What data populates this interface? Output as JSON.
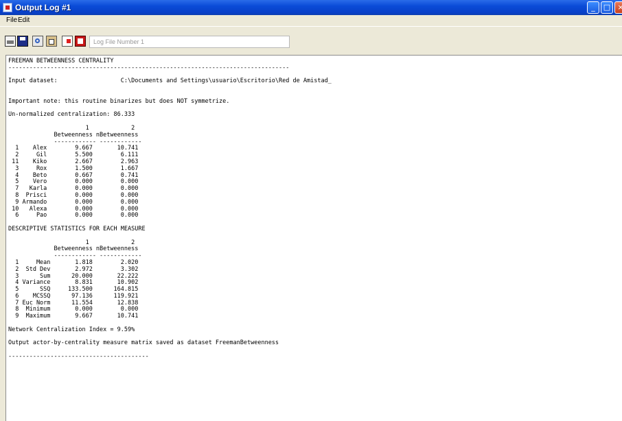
{
  "window": {
    "title": "Output Log #1",
    "controls": {
      "minimize": "_",
      "maximize": "□",
      "close": "×"
    }
  },
  "menu": {
    "file": "File",
    "edit": "Edit"
  },
  "toolbar": {
    "icons": [
      "print-icon",
      "save-icon",
      "find-icon",
      "clipboard-icon",
      "delete-icon",
      "exit-icon"
    ],
    "log_file_label": "Log File Number 1"
  },
  "output": {
    "text": "FREEMAN BETWEENNESS CENTRALITY\n--------------------------------------------------------------------------------\n\nInput dataset:                  C:\\Documents and Settings\\usuario\\Escritorio\\Red de Amistad_\n\n\nImportant note: this routine binarizes but does NOT symmetrize.\n\nUn-normalized centralization: 86.333\n\n                      1            2\n             Betweenness nBetweenness\n             ------------ ------------\n  1    Alex        9.667       10.741\n  2     Gil        5.500        6.111\n 11    Kiko        2.667        2.963\n  3     Rox        1.500        1.667\n  4    Beto        0.667        0.741\n  5    Vero        0.000        0.000\n  7   Karla        0.000        0.000\n  8  Prisci        0.000        0.000\n  9 Armando        0.000        0.000\n 10   Alexa        0.000        0.000\n  6     Pao        0.000        0.000\n\nDESCRIPTIVE STATISTICS FOR EACH MEASURE\n\n                      1            2\n             Betweenness nBetweenness\n             ------------ ------------\n  1     Mean       1.818        2.020\n  2  Std Dev       2.972        3.302\n  3      Sum      20.000       22.222\n  4 Variance       8.831       10.902\n  5      SSQ     133.500      164.815\n  6    MCSSQ      97.136      119.921\n  7 Euc Norm      11.554       12.838\n  8  Minimum       0.000        0.000\n  9  Maximum       9.667       10.741\n\nNetwork Centralization Index = 9.59%\n\nOutput actor-by-centrality measure matrix saved as dataset FreemanBetweenness\n\n----------------------------------------"
  }
}
